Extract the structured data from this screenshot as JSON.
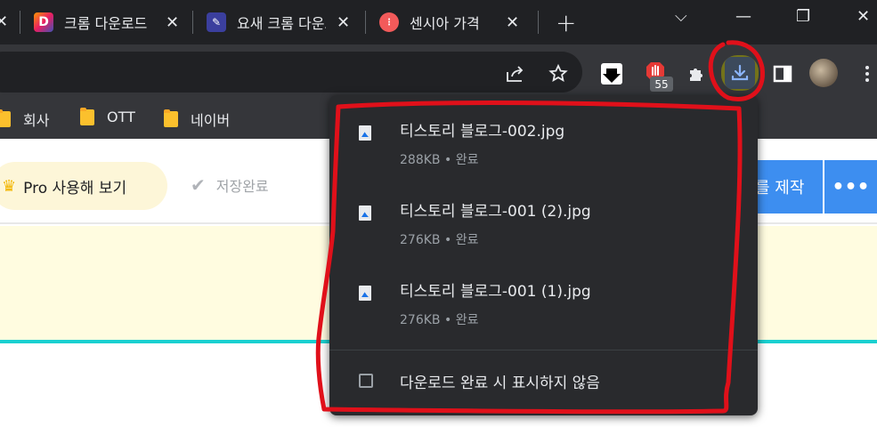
{
  "tabs": [
    {
      "icon": "close-icon",
      "close_glyph": "✕"
    },
    {
      "title": "크롬 다운로드",
      "favicon": "D",
      "favicon_name": "d-logo-icon",
      "close_glyph": "✕"
    },
    {
      "title": "요새 크롬 다운로드",
      "favicon": "",
      "favicon_name": "blue-app-icon",
      "close_glyph": "✕"
    },
    {
      "title": "센시아 가격",
      "favicon": "",
      "favicon_name": "red-circle-icon",
      "close_glyph": "✕"
    }
  ],
  "new_tab_glyph": "+",
  "window_controls": {
    "tab_search": "⌵",
    "minimize": "—",
    "restore": "❐",
    "close": "✕"
  },
  "toolbar": {
    "ext_badge": "55"
  },
  "bookmarks": [
    {
      "label": "회사"
    },
    {
      "label": "OTT"
    },
    {
      "label": "네이버"
    }
  ],
  "page": {
    "pro_button": "Pro 사용해 보기",
    "saved_status": "저장완료",
    "make_button": "를 제작",
    "more_button": "•••"
  },
  "downloads": {
    "items": [
      {
        "name": "티스토리 블로그-002.jpg",
        "size": "288KB",
        "status": "완료"
      },
      {
        "name": "티스토리 블로그-001 (2).jpg",
        "size": "276KB",
        "status": "완료"
      },
      {
        "name": "티스토리 블로그-001 (1).jpg",
        "size": "276KB",
        "status": "완료"
      }
    ],
    "dont_show_label": "다운로드 완료 시 표시하지 않음"
  },
  "colors": {
    "accent_blue": "#8ab4f8",
    "annotation_red": "#e0101a",
    "highlight_yellow": "#e8e000",
    "button_blue": "#3d8ef0"
  }
}
